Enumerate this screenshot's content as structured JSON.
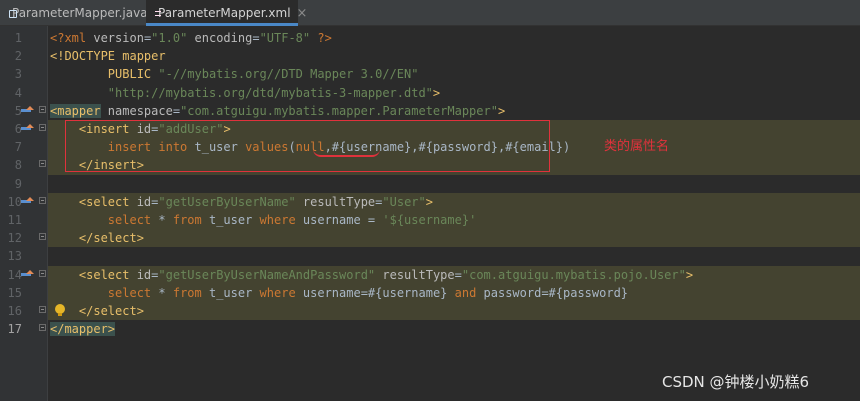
{
  "tabs": [
    {
      "label": "ParameterMapper.java",
      "icon": "java-class-icon",
      "active": false
    },
    {
      "label": "ParameterMapper.xml",
      "icon": "xml-file-icon",
      "active": true
    }
  ],
  "line_numbers": [
    "1",
    "2",
    "3",
    "4",
    "5",
    "6",
    "7",
    "8",
    "9",
    "10",
    "11",
    "12",
    "13",
    "14",
    "15",
    "16",
    "17"
  ],
  "code": {
    "l1": {
      "a": "<?xml ",
      "b": "version",
      "c": "=",
      "d": "\"1.0\"",
      "e": " encoding",
      "f": "=",
      "g": "\"UTF-8\"",
      "h": " ?>"
    },
    "l2": {
      "a": "<!DOCTYPE mapper"
    },
    "l3": {
      "a": "        PUBLIC ",
      "b": "\"-//mybatis.org//DTD Mapper 3.0//EN\""
    },
    "l4": {
      "a": "        ",
      "b": "\"http://mybatis.org/dtd/mybatis-3-mapper.dtd\"",
      "c": ">"
    },
    "l5": {
      "a": "<mapper",
      "b": " namespace",
      "c": "=",
      "d": "\"com.atguigu.mybatis.mapper.ParameterMapper\"",
      "e": ">"
    },
    "l6": {
      "a": "    ",
      "b": "<insert",
      "c": " id",
      "d": "=",
      "e": "\"addUser\"",
      "f": ">"
    },
    "l7": {
      "a": "        ",
      "b": "insert into",
      "c": " t_user ",
      "d": "values",
      "e": "(",
      "f": "null",
      "g": ",#{username}",
      "h": ",#{password}",
      "i": ",#{email})"
    },
    "l8": {
      "a": "    ",
      "b": "</insert>"
    },
    "l9": {
      "a": ""
    },
    "l10": {
      "a": "    ",
      "b": "<select",
      "c": " id",
      "d": "=",
      "e": "\"getUserByUserName\"",
      "f": " resultType",
      "g": "=",
      "h": "\"User\"",
      "i": ">"
    },
    "l11": {
      "a": "        ",
      "b": "select",
      "c": " * ",
      "d": "from",
      "e": " t_user ",
      "f": "where",
      "g": " username = ",
      "h": "'${username}'"
    },
    "l12": {
      "a": "    ",
      "b": "</select>"
    },
    "l13": {
      "a": ""
    },
    "l14": {
      "a": "    ",
      "b": "<select",
      "c": " id",
      "d": "=",
      "e": "\"getUserByUserNameAndPassword\"",
      "f": " resultType",
      "g": "=",
      "h": "\"com.atguigu.mybatis.pojo.User\"",
      "i": ">"
    },
    "l15": {
      "a": "        ",
      "b": "select",
      "c": " * ",
      "d": "from",
      "e": " t_user ",
      "f": "where",
      "g": " username=#{username} ",
      "h": "and",
      "i": " password=#{password}"
    },
    "l16": {
      "a": "    ",
      "b": "</select>"
    },
    "l17": {
      "a": "</mapper>"
    }
  },
  "annotation": "类的属性名",
  "watermark": "CSDN @钟楼小奶糕6",
  "colors": {
    "tag": "#e8bf6a",
    "string": "#6a8759",
    "keyword": "#cc7832",
    "annotation": "#e0323c",
    "highlight": "#444330"
  }
}
